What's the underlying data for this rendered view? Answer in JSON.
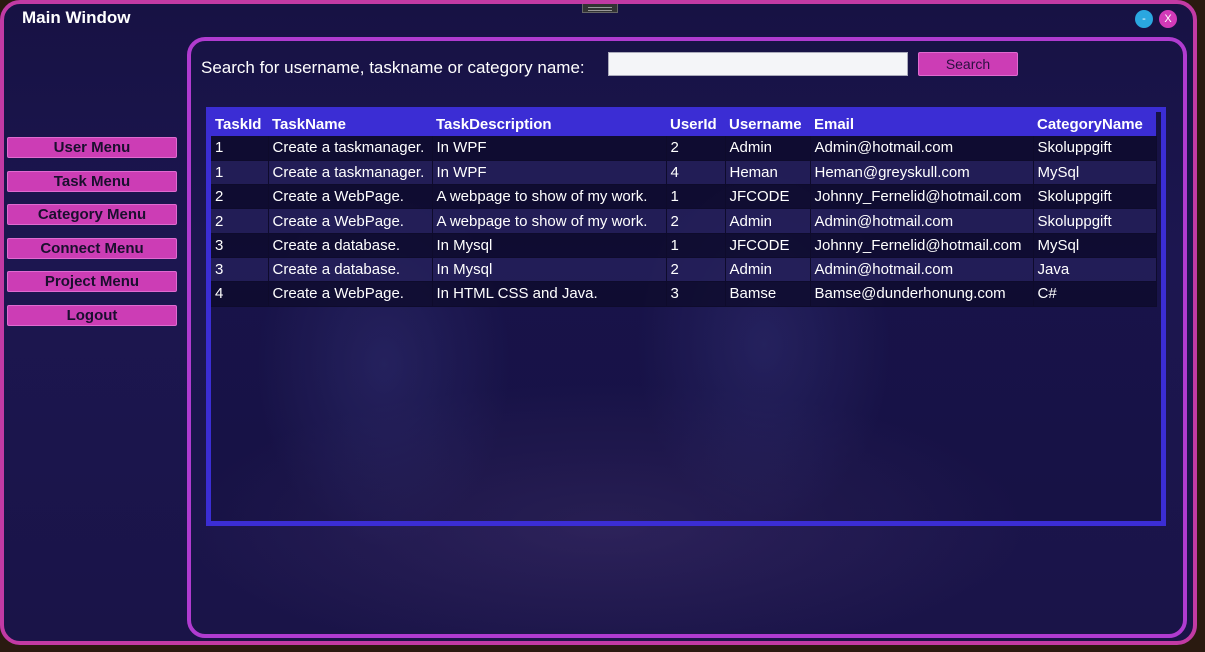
{
  "window": {
    "title": "Main Window",
    "minimize_label": "-",
    "close_label": "X"
  },
  "sidebar": {
    "items": [
      {
        "label": "User Menu"
      },
      {
        "label": "Task Menu"
      },
      {
        "label": "Category Menu"
      },
      {
        "label": "Connect Menu"
      },
      {
        "label": "Project Menu"
      },
      {
        "label": "Logout"
      }
    ]
  },
  "search": {
    "label": "Search for username, taskname or category name:",
    "value": "",
    "placeholder": "",
    "button_label": "Search"
  },
  "grid": {
    "columns": [
      "TaskId",
      "TaskName",
      "TaskDescription",
      "UserId",
      "Username",
      "Email",
      "CategoryName"
    ],
    "rows": [
      [
        "1",
        "Create a taskmanager.",
        "In WPF",
        "2",
        "Admin",
        "Admin@hotmail.com",
        "Skoluppgift"
      ],
      [
        "1",
        "Create a taskmanager.",
        "In WPF",
        "4",
        "Heman",
        "Heman@greyskull.com",
        "MySql"
      ],
      [
        "2",
        "Create a WebPage.",
        "A webpage to show of my work.",
        "1",
        "JFCODE",
        "Johnny_Fernelid@hotmail.com",
        "Skoluppgift"
      ],
      [
        "2",
        "Create a WebPage.",
        "A webpage to show of my work.",
        "2",
        "Admin",
        "Admin@hotmail.com",
        "Skoluppgift"
      ],
      [
        "3",
        "Create a database.",
        "In Mysql",
        "1",
        "JFCODE",
        "Johnny_Fernelid@hotmail.com",
        "MySql"
      ],
      [
        "3",
        "Create a database.",
        "In Mysql",
        "2",
        "Admin",
        "Admin@hotmail.com",
        "Java"
      ],
      [
        "4",
        "Create a WebPage.",
        "In HTML CSS and Java.",
        "3",
        "Bamse",
        "Bamse@dunderhonung.com",
        "C#"
      ]
    ]
  },
  "colors": {
    "accent": "#cc3db5",
    "grid_border": "#3b2dd4",
    "background": "#1a1448"
  }
}
